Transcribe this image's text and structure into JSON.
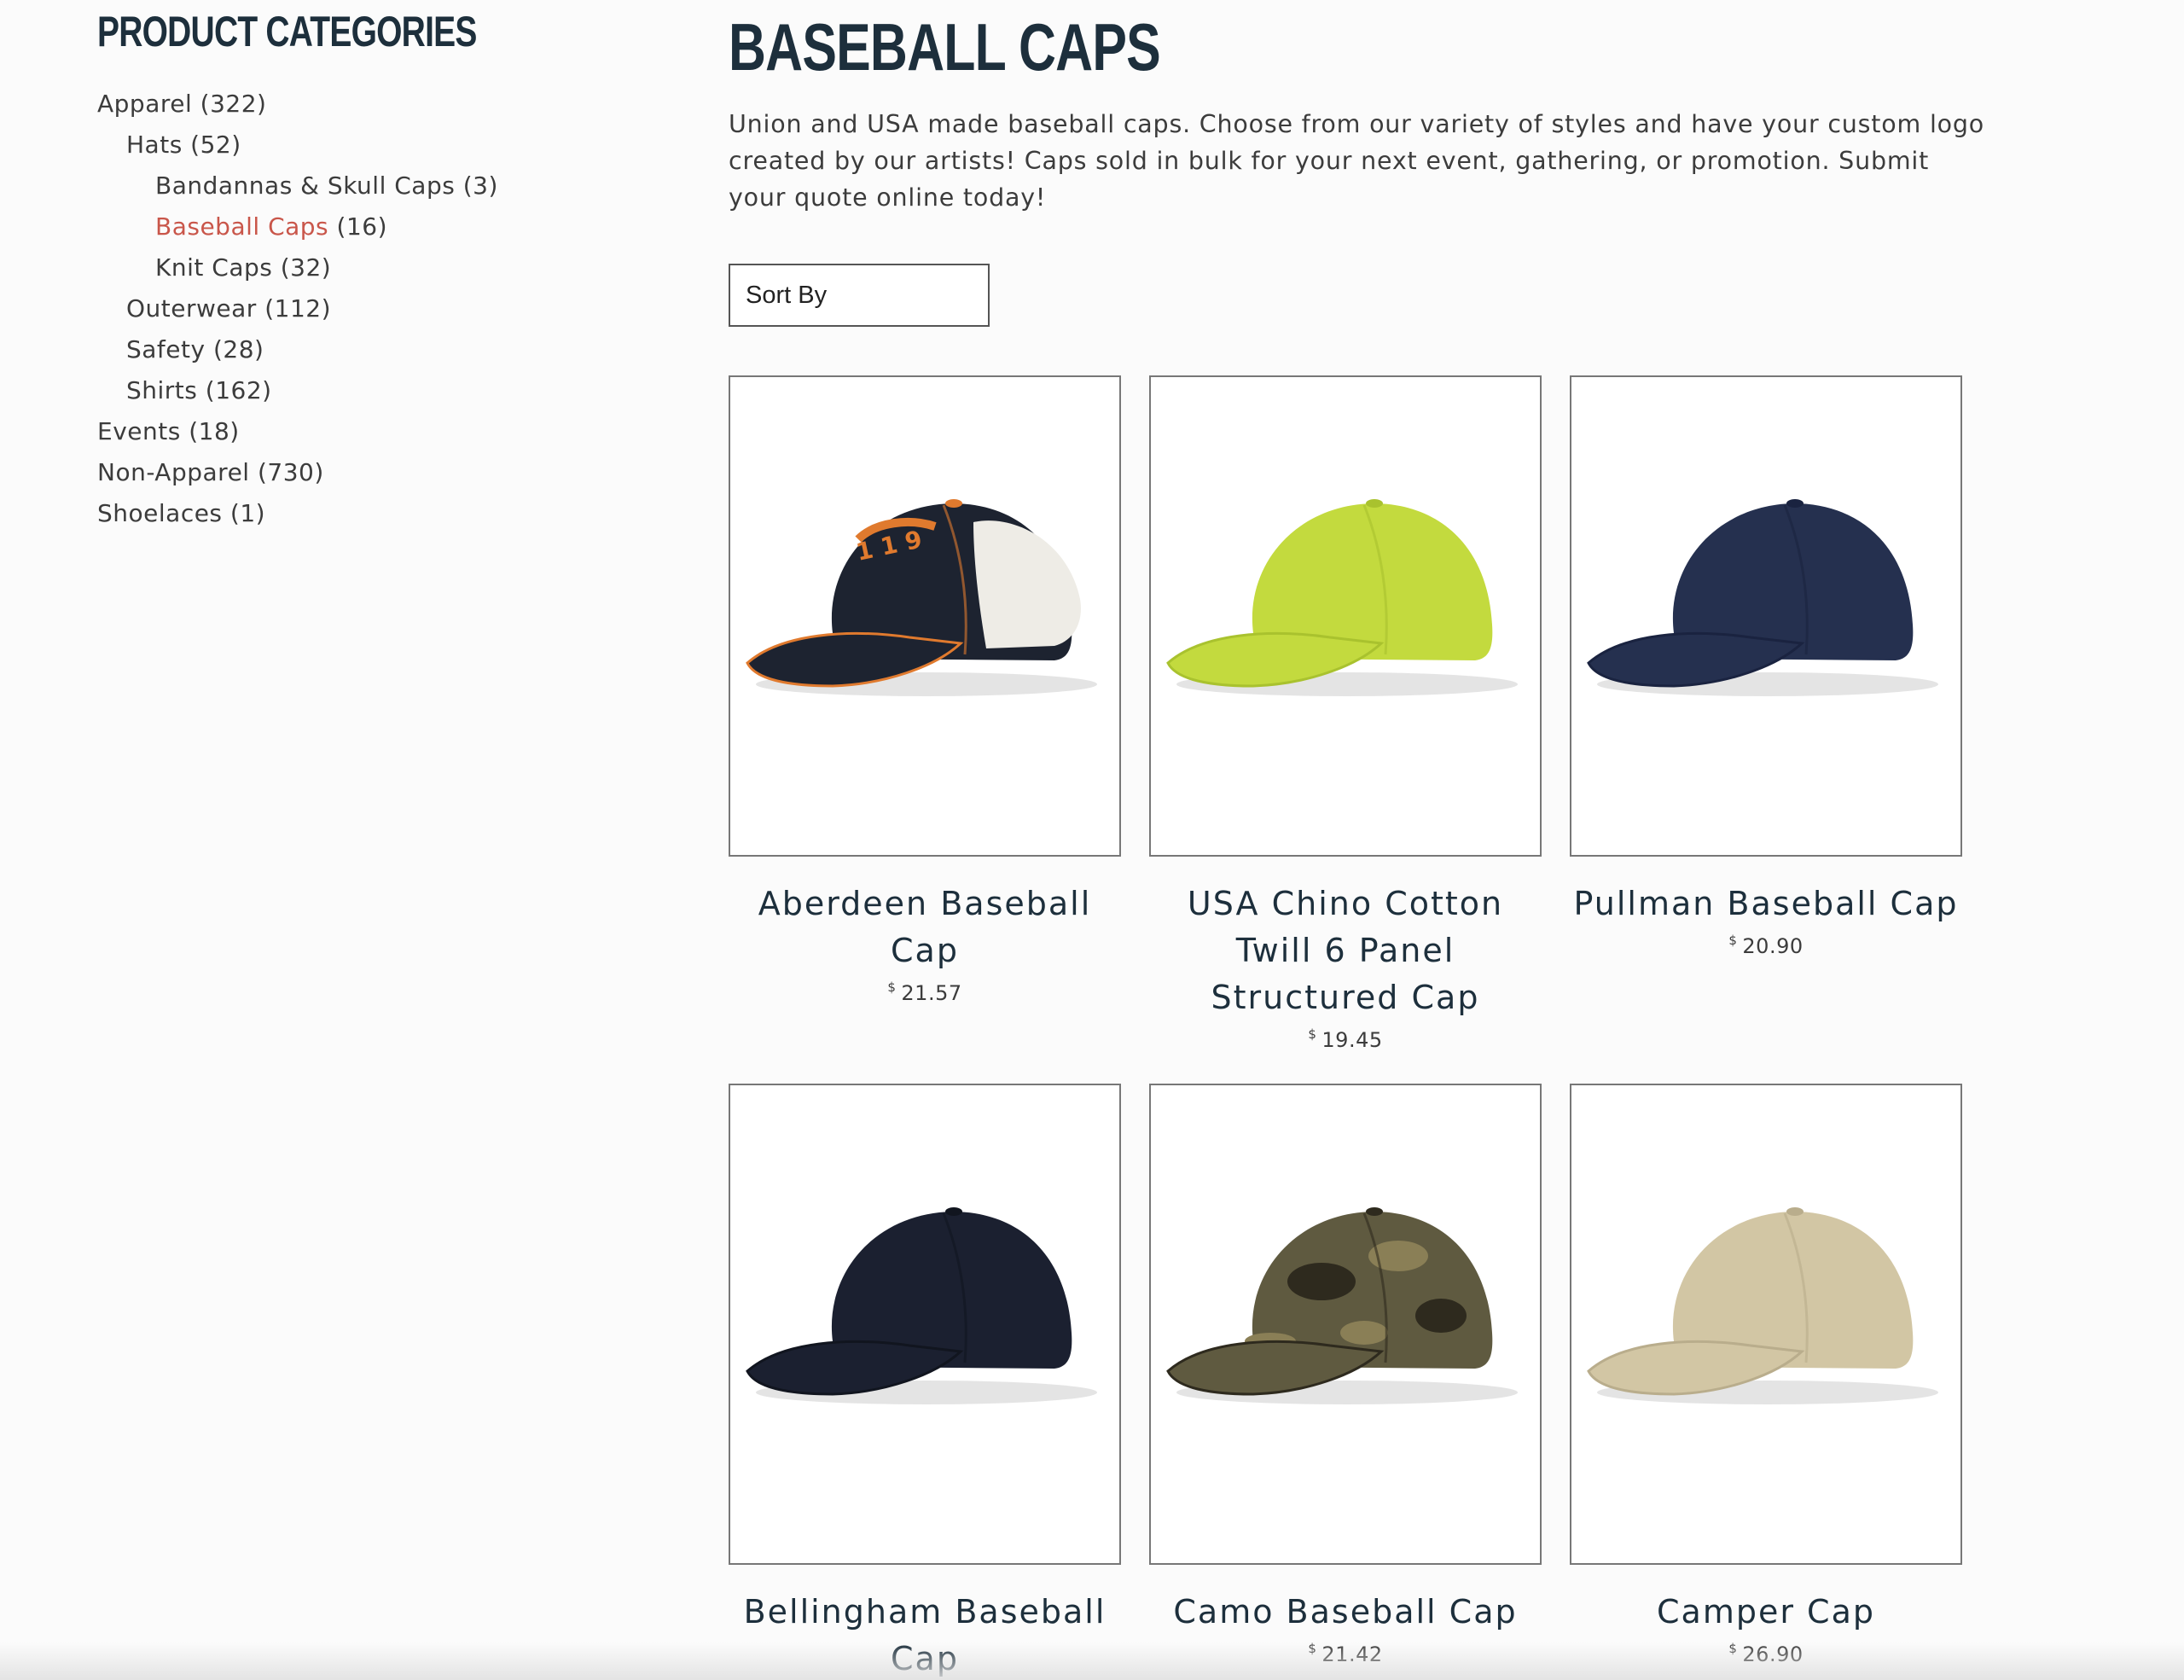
{
  "sidebar": {
    "title": "PRODUCT CATEGORIES",
    "categories": [
      {
        "label": "Apparel",
        "count": "(322)",
        "level": 1,
        "active": false
      },
      {
        "label": "Hats",
        "count": "(52)",
        "level": 2,
        "active": false
      },
      {
        "label": "Bandannas & Skull Caps",
        "count": "(3)",
        "level": 3,
        "active": false
      },
      {
        "label": "Baseball Caps",
        "count": "(16)",
        "level": 3,
        "active": true
      },
      {
        "label": "Knit Caps",
        "count": "(32)",
        "level": 3,
        "active": false
      },
      {
        "label": "Outerwear",
        "count": "(112)",
        "level": 2,
        "active": false
      },
      {
        "label": "Safety",
        "count": "(28)",
        "level": 2,
        "active": false
      },
      {
        "label": "Shirts",
        "count": "(162)",
        "level": 2,
        "active": false
      },
      {
        "label": "Events",
        "count": "(18)",
        "level": 1,
        "active": false
      },
      {
        "label": "Non-Apparel",
        "count": "(730)",
        "level": 1,
        "active": false
      },
      {
        "label": "Shoelaces",
        "count": "(1)",
        "level": 1,
        "active": false
      }
    ]
  },
  "main": {
    "title": "BASEBALL CAPS",
    "intro": "Union and USA made baseball caps. Choose from our variety of styles and have your custom logo created by our artists! Caps sold in bulk for your next event, gathering, or promotion. Submit your quote online today!",
    "sort_label": "Sort By"
  },
  "products": [
    {
      "name": "Aberdeen Baseball Cap",
      "currency": "$",
      "price": "21.57",
      "cap_color": "#1d2330",
      "back_color": "#eeece6",
      "accent": "#e07a2e",
      "icon": "cap-trucker-icon"
    },
    {
      "name": "USA Chino Cotton Twill 6 Panel Structured Cap",
      "currency": "$",
      "price": "19.45",
      "cap_color": "#c3da3e",
      "back_color": "#c3da3e",
      "accent": "#a9c22e",
      "icon": "cap-lime-icon"
    },
    {
      "name": "Pullman Baseball Cap",
      "currency": "$",
      "price": "20.90",
      "cap_color": "#25304f",
      "back_color": "#25304f",
      "accent": "#1a2340",
      "icon": "cap-navy-icon"
    },
    {
      "name": "Bellingham Baseball Cap",
      "currency": "$",
      "price": "",
      "cap_color": "#1b2030",
      "back_color": "#1b2030",
      "accent": "#11151f",
      "icon": "cap-black-icon"
    },
    {
      "name": "Camo Baseball Cap",
      "currency": "$",
      "price": "21.42",
      "cap_color": "#5f5a40",
      "back_color": "#5f5a40",
      "accent": "#2e2a1e",
      "icon": "cap-camo-icon"
    },
    {
      "name": "Camper Cap",
      "currency": "$",
      "price": "26.90",
      "cap_color": "#d2c6a4",
      "back_color": "#d2c6a4",
      "accent": "#b9ad8c",
      "icon": "cap-khaki-icon"
    }
  ],
  "colors": {
    "heading": "#1d2f3c",
    "active_link": "#c9564a",
    "text": "#3c3c3c"
  }
}
